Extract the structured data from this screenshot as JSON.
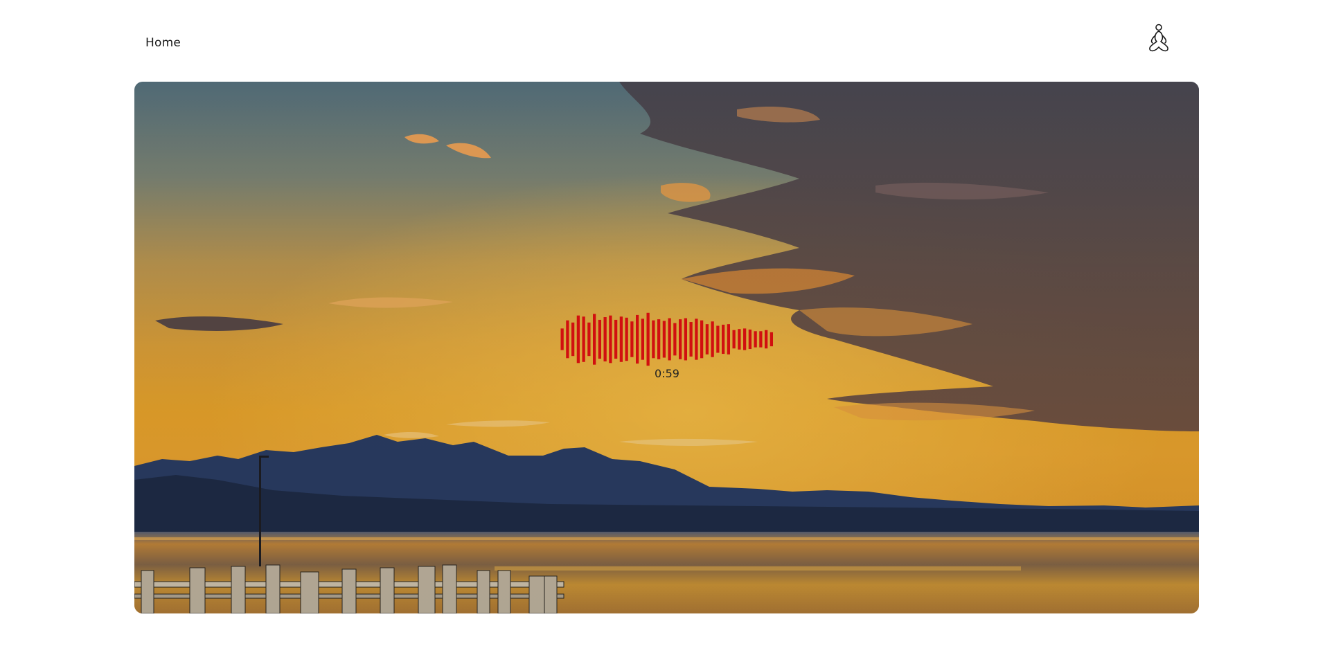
{
  "nav": {
    "home_label": "Home",
    "profile_icon": "meditation-person-icon"
  },
  "hero": {
    "scene": "sunset-lake-mountains-pier"
  },
  "player": {
    "elapsed": "0:59",
    "waveform_color": "#d10f0f",
    "waveform_levels": [
      0.4,
      0.7,
      0.62,
      0.88,
      0.84,
      0.62,
      0.94,
      0.72,
      0.82,
      0.88,
      0.72,
      0.84,
      0.8,
      0.66,
      0.9,
      0.76,
      0.98,
      0.7,
      0.74,
      0.68,
      0.78,
      0.6,
      0.74,
      0.78,
      0.64,
      0.76,
      0.7,
      0.56,
      0.66,
      0.5,
      0.54,
      0.56,
      0.34,
      0.38,
      0.4,
      0.36,
      0.3,
      0.3,
      0.34,
      0.26
    ]
  }
}
